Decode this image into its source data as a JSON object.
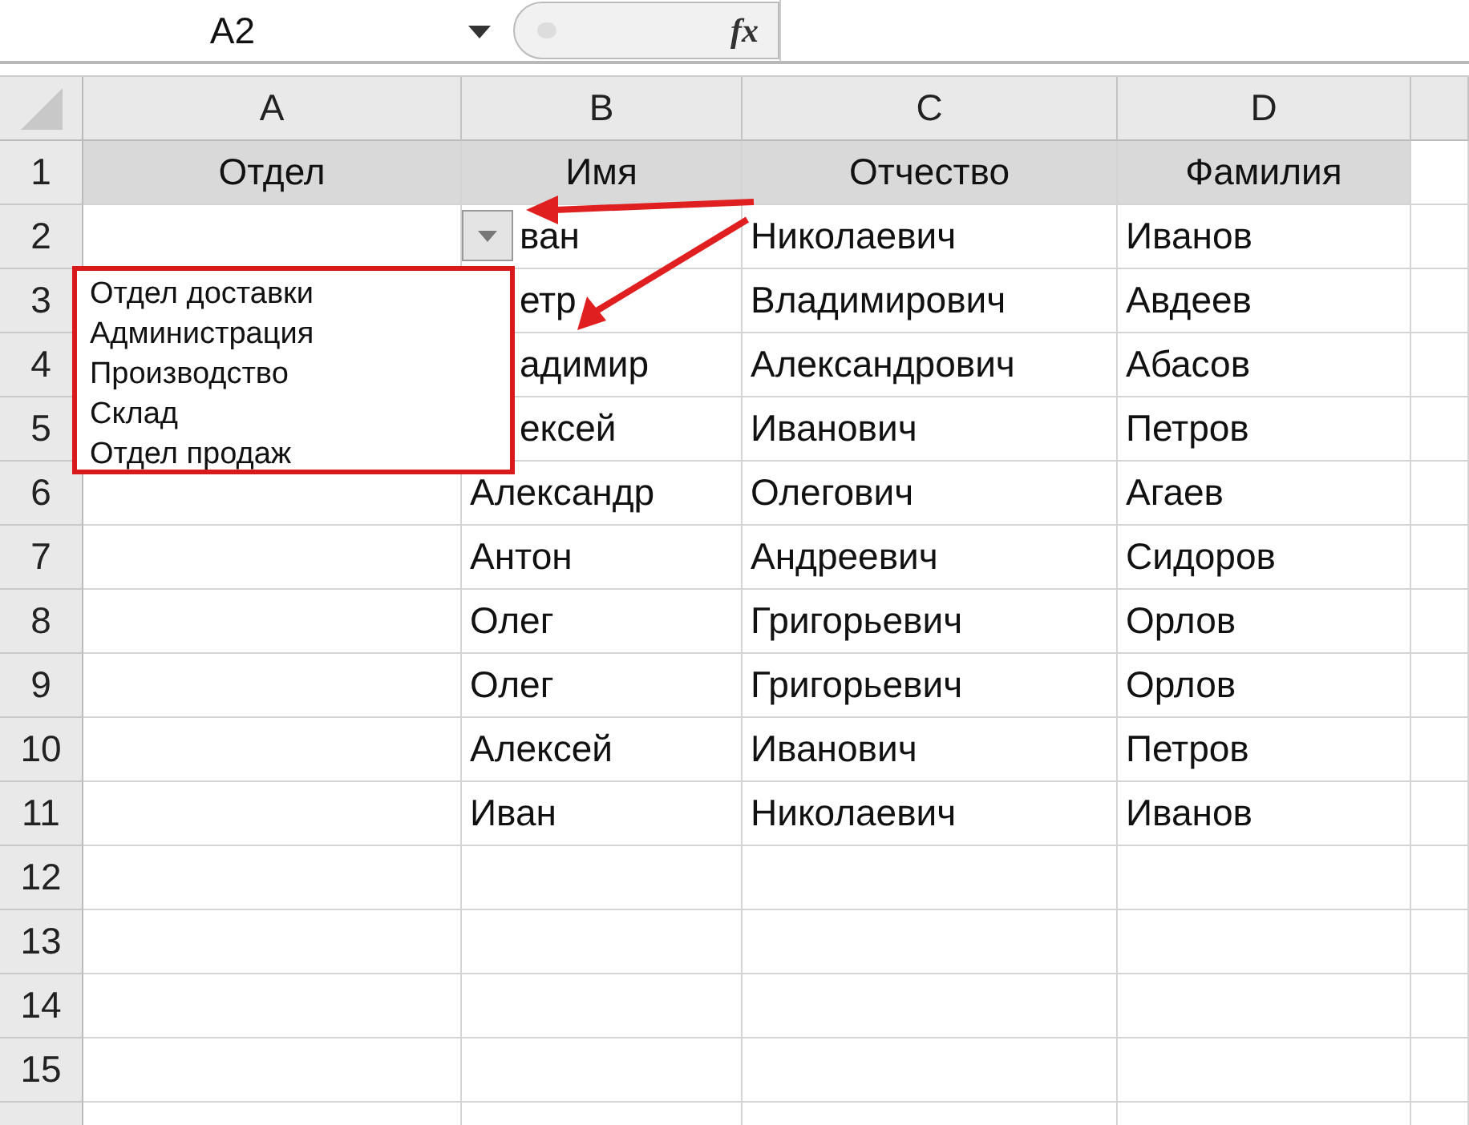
{
  "name_box": {
    "value": "A2"
  },
  "formula_bar": {
    "function_label": "fx"
  },
  "table": {
    "columns": [
      "A",
      "B",
      "C",
      "D"
    ],
    "header_row": {
      "number": "1",
      "cells": [
        "Отдел",
        "Имя",
        "Отчество",
        "Фамилия"
      ]
    },
    "rows": [
      {
        "number": "2",
        "cells": [
          "",
          "ван",
          "Николаевич",
          "Иванов"
        ]
      },
      {
        "number": "3",
        "cells": [
          "",
          "етр",
          "Владимирович",
          "Авдеев"
        ]
      },
      {
        "number": "4",
        "cells": [
          "",
          "адимир",
          "Александрович",
          "Абасов"
        ]
      },
      {
        "number": "5",
        "cells": [
          "",
          "ексей",
          "Иванович",
          "Петров"
        ]
      },
      {
        "number": "6",
        "cells": [
          "",
          "Александр",
          "Олегович",
          "Агаев"
        ]
      },
      {
        "number": "7",
        "cells": [
          "",
          "Антон",
          "Андреевич",
          "Сидоров"
        ]
      },
      {
        "number": "8",
        "cells": [
          "",
          "Олег",
          "Григорьевич",
          "Орлов"
        ]
      },
      {
        "number": "9",
        "cells": [
          "",
          "Олег",
          "Григорьевич",
          "Орлов"
        ]
      },
      {
        "number": "10",
        "cells": [
          "",
          "Алексей",
          "Иванович",
          "Петров"
        ]
      },
      {
        "number": "11",
        "cells": [
          "",
          "Иван",
          "Николаевич",
          "Иванов"
        ]
      },
      {
        "number": "12"
      },
      {
        "number": "13"
      },
      {
        "number": "14"
      },
      {
        "number": "15"
      }
    ]
  },
  "dropdown": {
    "items": [
      "Отдел доставки",
      "Администрация",
      "Производство",
      "Склад",
      "Отдел продаж"
    ]
  }
}
